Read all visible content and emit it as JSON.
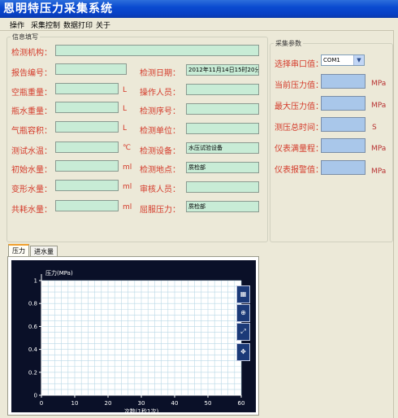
{
  "window": {
    "title": "恩明特压力采集系统"
  },
  "menu": [
    "操作",
    "采集控制",
    "数据打印",
    "关于"
  ],
  "info": {
    "legend": "信息填写",
    "inspect_org_label": "检测机构：",
    "report_no_label": "报告编号：",
    "empty_weight_label": "空瓶重量：",
    "bottle_water_label": "瓶水重量：",
    "cylinder_volume_label": "气瓶容积：",
    "water_temp_label": "测试水温：",
    "initial_water_label": "初始水量：",
    "deform_water_label": "变形水量：",
    "consume_water_label": "共耗水量：",
    "test_date_label": "检测日期：",
    "operator_label": "操作人员：",
    "serial_label": "检测序号：",
    "unit_label": "检测单位：",
    "equipment_label": "检测设备：",
    "location_label": "检测地点：",
    "reviewer_label": "审核人员：",
    "yield_pressure_label": "屈服压力：",
    "test_date_value": "2012年11月14日15时20分",
    "equipment_value": "水压试验设备",
    "location_value": "质检部",
    "yield_pressure_value": "质检部",
    "unit_L1": "L",
    "unit_L2": "L",
    "unit_L3": "L",
    "unit_C": "℃",
    "unit_ml1": "ml",
    "unit_ml2": "ml",
    "unit_ml3": "ml"
  },
  "params": {
    "legend": "采集参数",
    "port_label": "选择串口值：",
    "port_value": "COM1",
    "current_pressure_label": "当前压力值：",
    "max_pressure_label": "最大压力值：",
    "total_time_label": "测压总时间：",
    "full_range_label": "仪表满量程：",
    "alarm_label": "仪表报警值：",
    "unit_mpa1": "MPa",
    "unit_mpa2": "MPa",
    "unit_s": "S",
    "unit_mpa3": "MPa",
    "unit_mpa4": "MPa"
  },
  "tabs": [
    "压力",
    "进水量"
  ],
  "chart_data": {
    "type": "line",
    "ylabel": "压力(MPa)",
    "xlabel": "次数(1秒1次)",
    "xlim": [
      0,
      60
    ],
    "ylim": [
      0,
      1
    ],
    "x_ticks": [
      0,
      10,
      20,
      30,
      40,
      50,
      60
    ],
    "y_ticks": [
      "0",
      "0.2",
      "0.4",
      "0.6",
      "0.8",
      "1"
    ],
    "series": [],
    "grid": true
  },
  "colors": {
    "title_bar": "#0a4ad0",
    "field_green": "#c8ecd6",
    "field_blue": "#a9c7ea",
    "label_red": "#d43a2a",
    "chart_bg": "#0a1028"
  }
}
